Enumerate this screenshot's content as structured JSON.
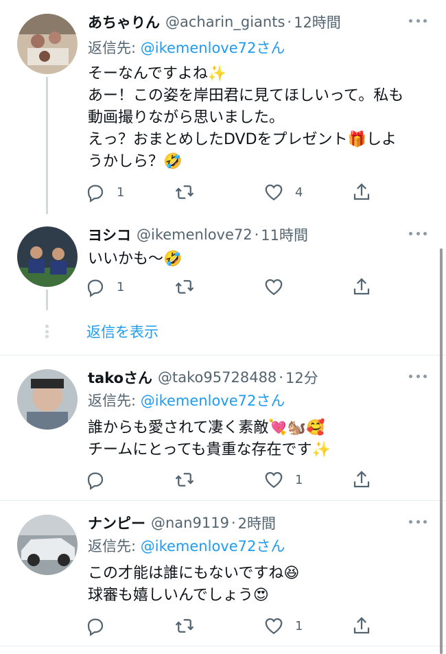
{
  "tweets": [
    {
      "name": "あちゃりん",
      "handle": "@acharin_giants",
      "separator": "·",
      "time": "12時間",
      "reply_prefix": "返信先: ",
      "reply_to": "@ikemenlove72さん",
      "text": "そーなんですよね✨\nあー！この姿を岸田君に見てほしいって。私も\n動画撮りながら思いました。\nえっ？おまとめしたDVDをプレゼント🎁しよ\nうかしら？🤣",
      "replies": "1",
      "retweets": "",
      "likes": "4"
    },
    {
      "name": "ヨシコ",
      "handle": "@ikemenlove72",
      "separator": "·",
      "time": "11時間",
      "text": "いいかも〜🤣",
      "replies": "1",
      "retweets": "",
      "likes": ""
    },
    {
      "name": "takoさん",
      "handle": "@tako95728488",
      "separator": "·",
      "time": "12分",
      "reply_prefix": "返信先: ",
      "reply_to": "@ikemenlove72さん",
      "text": "誰からも愛されて凄く素敵💘🐿️🥰\nチームにとっても貴重な存在です✨",
      "replies": "",
      "retweets": "",
      "likes": "1"
    },
    {
      "name": "ナンピー",
      "handle": "@nan9119",
      "separator": "·",
      "time": "2時間",
      "reply_prefix": "返信先: ",
      "reply_to": "@ikemenlove72さん",
      "text": "この才能は誰にもないですね😆\n球審も嬉しいんでしょう😍",
      "replies": "",
      "retweets": "",
      "likes": "1"
    }
  ],
  "show_replies_label": "返信を表示",
  "colors": {
    "link": "#1d9bf0",
    "secondary_text": "#536471",
    "thread_line": "#cfd9de",
    "divider": "#e6ecf0"
  },
  "icons": [
    "reply-icon",
    "retweet-icon",
    "like-icon",
    "share-icon",
    "more-icon"
  ]
}
